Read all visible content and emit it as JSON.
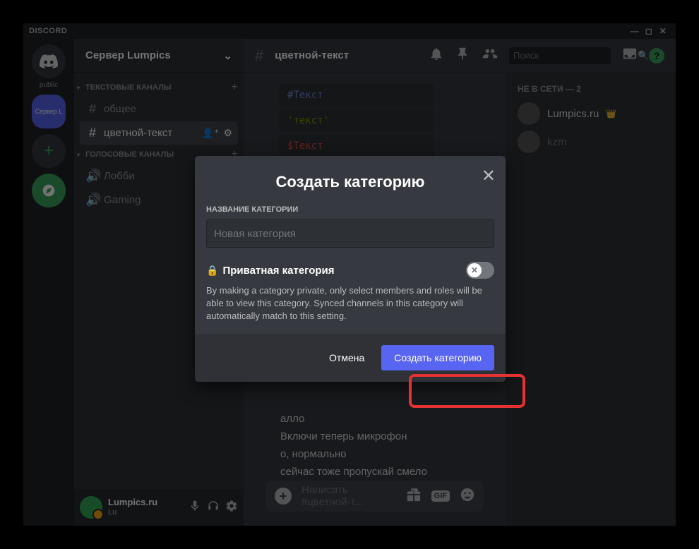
{
  "titlebar": {
    "brand": "DISCORD"
  },
  "guilds": {
    "public_label": "public",
    "srv_label": "Сервер L"
  },
  "server": {
    "name": "Сервер Lumpics",
    "text_category": "ТЕКСТОВЫЕ КАНАЛЫ",
    "voice_category": "ГОЛОСОВЫЕ КАНАЛЫ",
    "channels": {
      "text": [
        {
          "name": "общее"
        },
        {
          "name": "цветной-текст",
          "active": true
        }
      ],
      "voice": [
        {
          "name": "Лобби"
        },
        {
          "name": "Gaming"
        }
      ]
    }
  },
  "user": {
    "name": "Lumpics.ru",
    "sub": "Lu"
  },
  "chat": {
    "channel_name": "цветной-текст",
    "search_placeholder": "Поиск",
    "code_blocks": [
      "#Текст",
      "'текст'",
      "$Текст"
    ],
    "lines": [
      "алло",
      "Включи теперь микрофон",
      "о, нормально",
      "сейчас тоже пропускай смело"
    ],
    "input_placeholder": "Написать #цветной-т...",
    "gif_label": "GIF"
  },
  "members": {
    "header": "НЕ В СЕТИ — 2",
    "list": [
      {
        "name": "Lumpics.ru",
        "owner": true
      },
      {
        "name": "kzm"
      }
    ]
  },
  "modal": {
    "title": "Создать категорию",
    "field_label": "НАЗВАНИЕ КАТЕГОРИИ",
    "placeholder": "Новая категория",
    "private_label": "Приватная категория",
    "private_desc": "By making a category private, only select members and roles will be able to view this category. Synced channels in this category will automatically match to this setting.",
    "cancel": "Отмена",
    "submit": "Создать категорию"
  }
}
